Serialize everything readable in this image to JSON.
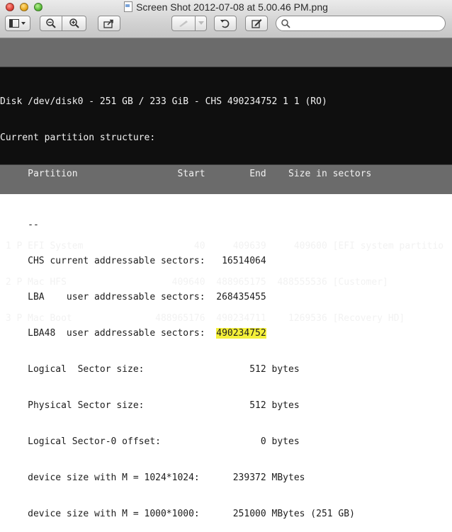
{
  "window": {
    "title": "Screen Shot 2012-07-08 at 5.00.46 PM.png"
  },
  "toolbar": {
    "sidebar_button": "sidebar-icon",
    "zoom_out": "zoom-out-icon",
    "zoom_in": "zoom-in-icon",
    "share": "share-icon",
    "annotate": "pen-icon",
    "rotate": "rotate-icon",
    "edit": "edit-icon",
    "search_placeholder": ""
  },
  "terminal": {
    "lines": [
      "Disk /dev/disk0 - 251 GB / 233 GiB - CHS 490234752 1 1 (RO)",
      "Current partition structure:",
      "     Partition                  Start        End    Size in sectors",
      "",
      " 1 P EFI System                    40     409639     409600 [EFI system partitio",
      " 2 P Mac HFS                   409640  488965175  488555536 [Customer]",
      " 3 P Mac Boot               488965176  490234711    1269536 [Recovery HD]"
    ]
  },
  "document": {
    "lines": [
      "     --",
      "     CHS current addressable sectors:   16514064",
      "     LBA    user addressable sectors:  268435455",
      "     LBA48  user addressable sectors:  ",
      "     Logical  Sector size:                   512 bytes",
      "     Physical Sector size:                   512 bytes",
      "     Logical Sector-0 offset:                  0 bytes",
      "     device size with M = 1024*1024:      239372 MBytes",
      "     device size with M = 1000*1000:      251000 MBytes (251 GB)"
    ],
    "highlight_value": "490234752",
    "highlight_color": "#f4f03a"
  }
}
